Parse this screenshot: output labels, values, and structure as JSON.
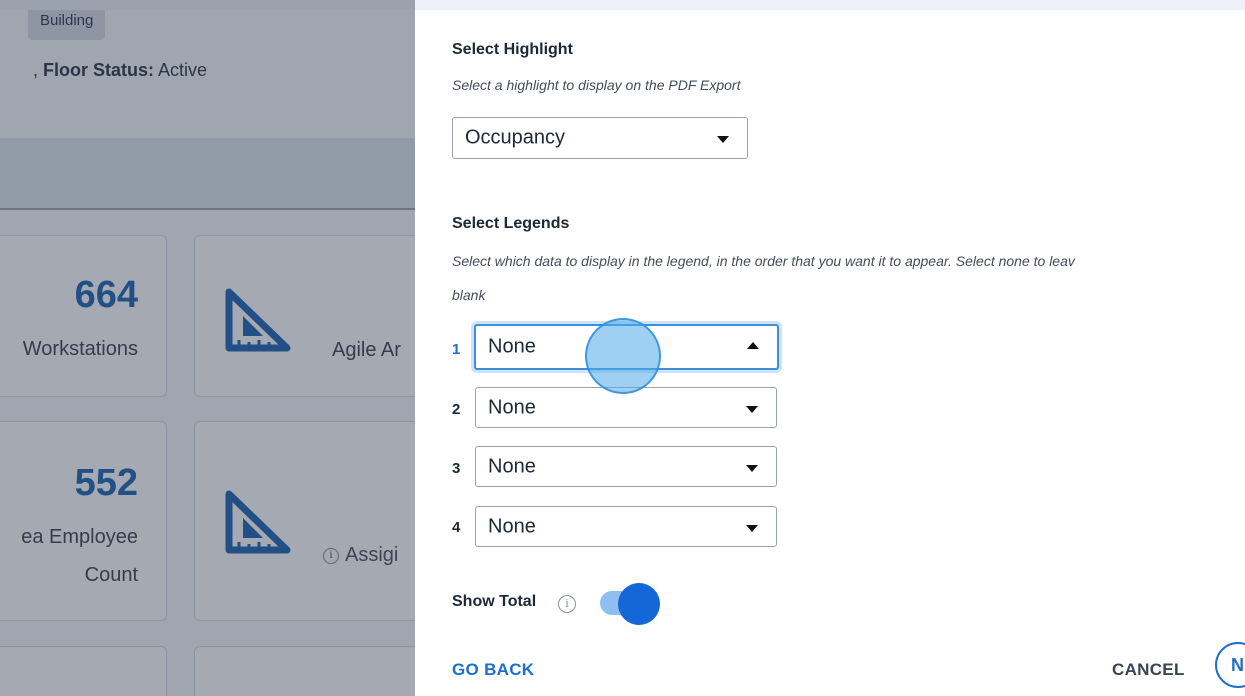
{
  "background": {
    "chip_label": "Building",
    "floor_status_label": "Floor Status:",
    "floor_status_prefix": ",",
    "floor_status_value": "Active",
    "cards": [
      {
        "value": "664",
        "label": "Workstations"
      },
      {
        "label": "Agile Ar"
      },
      {
        "value": "552",
        "label_line1": "ea Employee",
        "label_line2": "Count"
      },
      {
        "label": "Assigi"
      }
    ],
    "info_glyph": "i"
  },
  "dialog": {
    "highlight": {
      "heading": "Select Highlight",
      "description": "Select a highlight to display on the PDF Export",
      "selected": "Occupancy"
    },
    "legends": {
      "heading": "Select Legends",
      "description_line1": "Select which data to display in the legend, in the order that you want it to appear. Select none to leav",
      "description_line2": "blank",
      "items": [
        {
          "index": "1",
          "value": "None"
        },
        {
          "index": "2",
          "value": "None"
        },
        {
          "index": "3",
          "value": "None"
        },
        {
          "index": "4",
          "value": "None"
        }
      ]
    },
    "show_total": {
      "label": "Show Total",
      "info_glyph": "i",
      "enabled": true
    },
    "buttons": {
      "go_back": "GO BACK",
      "cancel": "CANCEL",
      "next": "N"
    },
    "colors": {
      "accent": "#1467d6",
      "link": "#1e6fcc"
    }
  }
}
